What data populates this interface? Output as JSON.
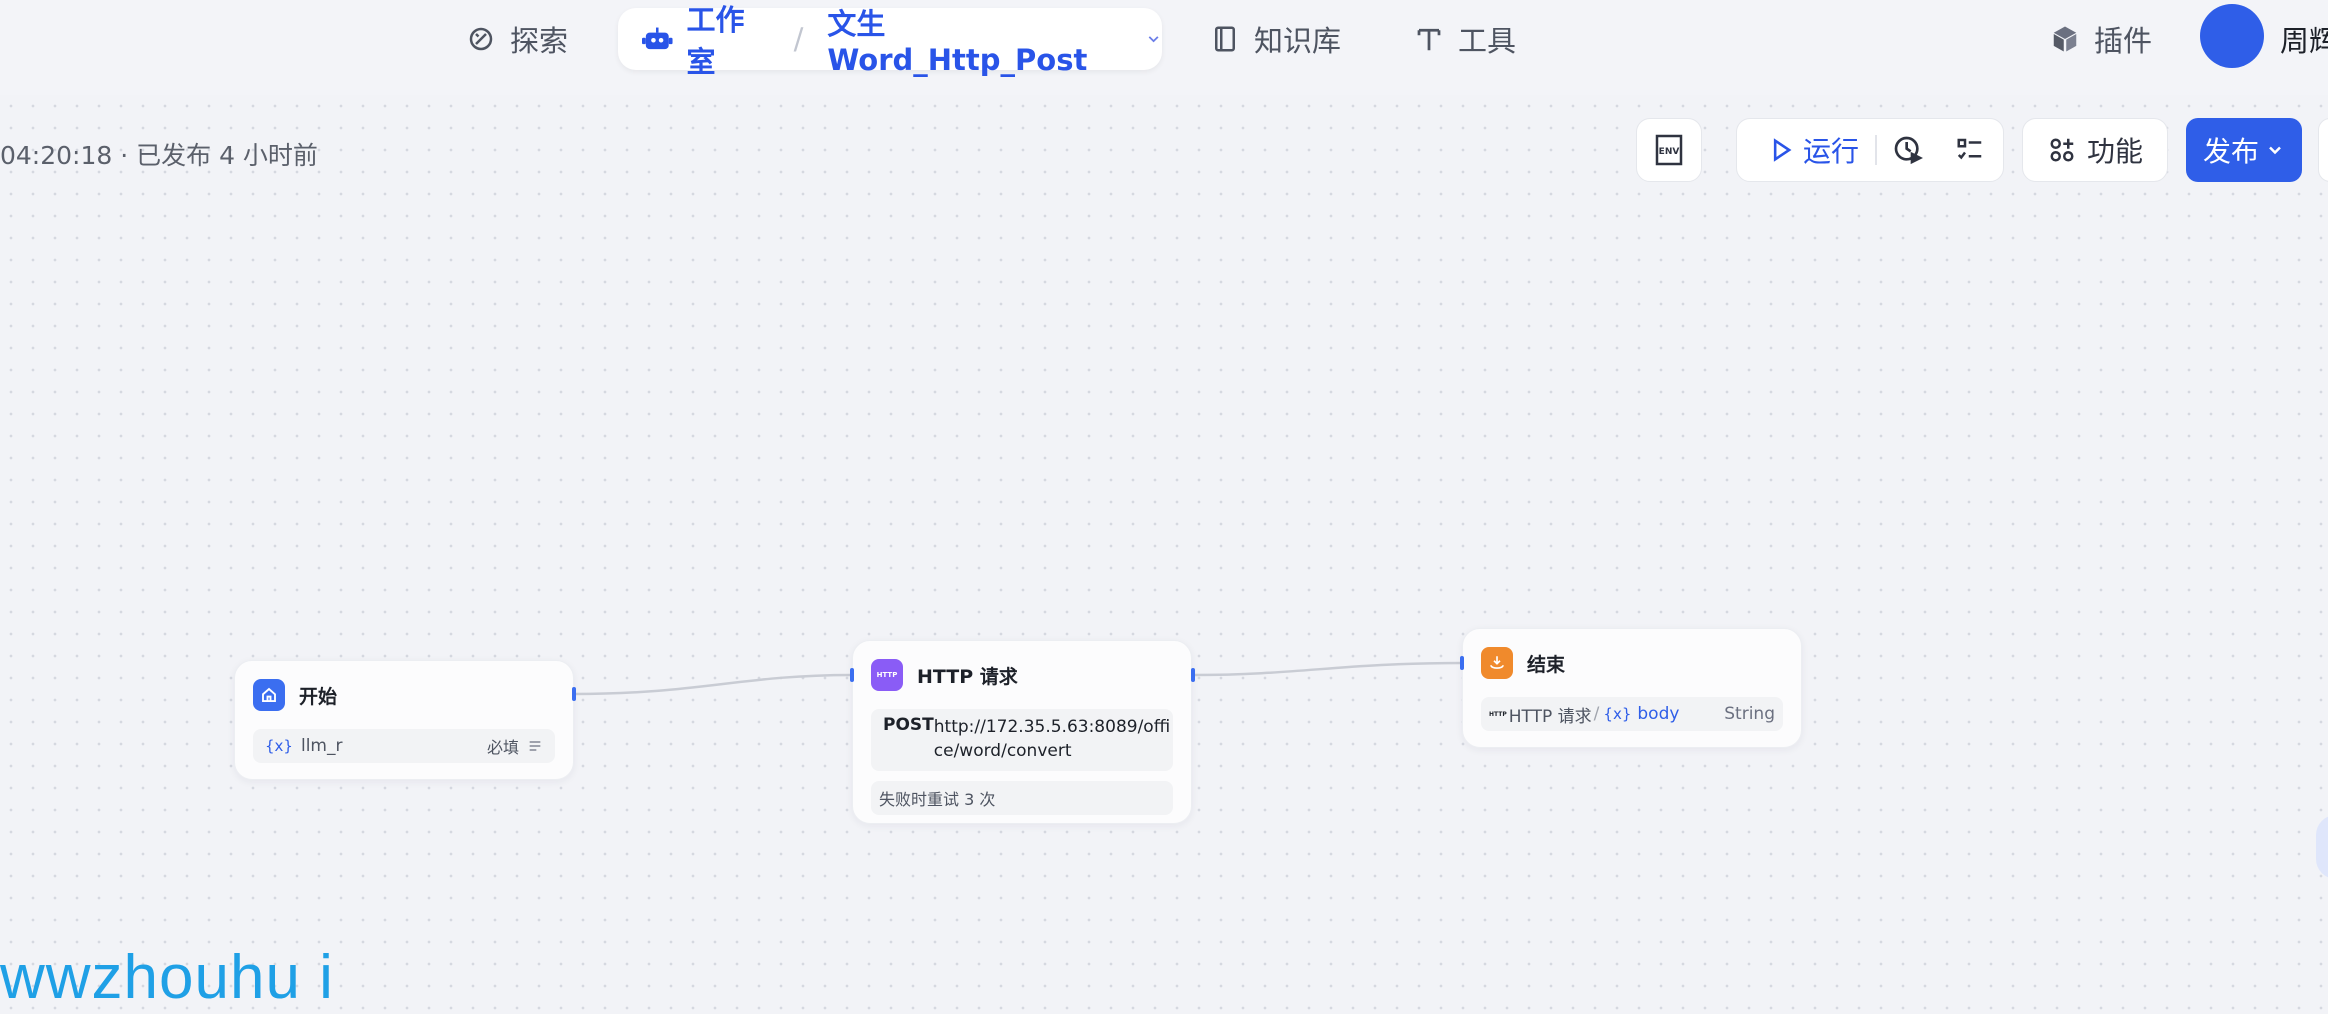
{
  "nav": {
    "explore": "探索",
    "studio": "工作室",
    "workflow_name": "文生Word_Http_Post",
    "knowledge": "知识库",
    "tools": "工具",
    "plugins": "插件",
    "username": "周辉"
  },
  "toolbar": {
    "status": "04:20:18 · 已发布 4 小时前",
    "env_label": "ENV",
    "run_label": "运行",
    "features_label": "功能",
    "publish_label": "发布"
  },
  "nodes": {
    "start": {
      "title": "开始",
      "var_name": "llm_r",
      "required": "必填"
    },
    "http": {
      "title": "HTTP 请求",
      "icon_text": "HTTP",
      "method": "POST",
      "url_line1": "http://172.35.5.63:8089/offi",
      "url_line2": "ce/word/convert",
      "retry": "失败时重试 3 次"
    },
    "end": {
      "title": "结束",
      "source_node": "HTTP 请求",
      "source_icon_text": "HTTP",
      "slash": "/",
      "var_name": "body",
      "var_type": "String"
    }
  },
  "watermark": "wwzhouhu i",
  "colors": {
    "accent": "#2f5ee8",
    "start_icon": "#3b6ef0",
    "http_icon": "#8a5cf6",
    "end_icon": "#f08a2c",
    "watermark": "#1fa0e6"
  }
}
